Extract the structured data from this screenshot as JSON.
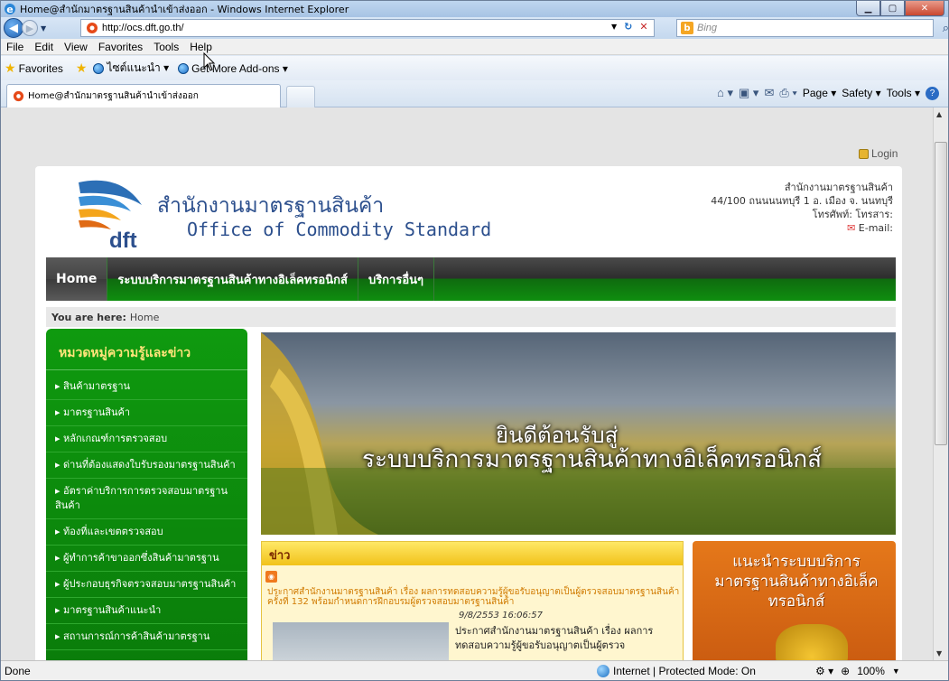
{
  "window": {
    "title": "Home@สำนักมาตรฐานสินค้านำเข้าส่งออก - Windows Internet Explorer"
  },
  "navbar": {
    "url": "http://ocs.dft.go.th/",
    "search_placeholder": "Bing"
  },
  "menu": [
    "File",
    "Edit",
    "View",
    "Favorites",
    "Tools",
    "Help"
  ],
  "favorites": {
    "label": "Favorites",
    "items": [
      "ไซต์แนะนำ ▾",
      "Get More Add-ons ▾"
    ]
  },
  "tab": {
    "title": "Home@สำนักมาตรฐานสินค้านำเข้าส่งออก"
  },
  "commands": {
    "page": "Page ▾",
    "safety": "Safety ▾",
    "tools": "Tools ▾"
  },
  "login": "Login",
  "site": {
    "title_th": "สำนักงานมาตรฐานสินค้า",
    "title_en": "Office of Commodity Standard",
    "logo_text": "dft"
  },
  "contact": {
    "line1": "สำนักงานมาตรฐานสินค้า",
    "line2": "44/100 ถนนนนทบุรี 1 อ. เมือง จ. นนทบุรี",
    "line3": "โทรศัพท์: โทรสาร:",
    "email": "E-mail:"
  },
  "mainnav": [
    "Home",
    "ระบบบริการมาตรฐานสินค้าทางอิเล็คทรอนิกส์",
    "บริการอื่นๆ"
  ],
  "breadcrumb": {
    "prefix": "You are here:",
    "current": "Home"
  },
  "sidebar": {
    "title": "หมวดหมู่ความรู้และข่าว",
    "items": [
      "สินค้ามาตรฐาน",
      "มาตรฐานสินค้า",
      "หลักเกณฑ์การตรวจสอบ",
      "ด่านที่ต้องแสดงใบรับรองมาตรฐานสินค้า",
      "อัตราค่าบริการการตรวจสอบมาตรฐานสินค้า",
      "ท้องที่และเขตตรวจสอบ",
      "ผู้ทำการค้าขาออกซึ่งสินค้ามาตรฐาน",
      "ผู้ประกอบธุรกิจตรวจสอบมาตรฐานสินค้า",
      "มาตรฐานสินค้าแนะนำ",
      "สถานการณ์การค้าสินค้ามาตรฐาน"
    ]
  },
  "banner": {
    "line1": "ยินดีต้อนรับสู่",
    "line2": "ระบบบริการมาตรฐานสินค้าทางอิเล็คทรอนิกส์"
  },
  "news": {
    "title": "ข่าว",
    "headline": "ประกาศสำนักงานมาตรฐานสินค้า เรื่อง ผลการทดสอบความรู้ผู้ขอรับอนุญาตเป็นผู้ตรวจสอบมาตรฐานสินค้า ครั้งที่ 132 พร้อมกำหนดการฝึกอบรมผู้ตรวจสอบมาตรฐานสินค้า",
    "date": "9/8/2553 16:06:57",
    "body": "ประกาศสำนักงานมาตรฐานสินค้า เรื่อง ผลการทดสอบความรู้ผู้ขอรับอนุญาตเป็นผู้ตรวจ"
  },
  "promo": {
    "text": "แนะนำระบบบริการมาตรฐานสินค้าทางอิเล็คทรอนิกส์"
  },
  "status": {
    "left": "Done",
    "zone": "Internet | Protected Mode: On",
    "zoom": "100%"
  }
}
